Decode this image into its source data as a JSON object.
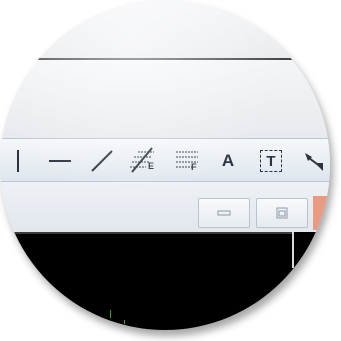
{
  "toolbar": {
    "tools": [
      {
        "name": "vertical-line-tool-icon",
        "label": ""
      },
      {
        "name": "horizontal-line-tool-icon",
        "label": ""
      },
      {
        "name": "diagonal-line-tool-icon",
        "label": ""
      },
      {
        "name": "fibonacci-extension-tool-icon",
        "label": "E"
      },
      {
        "name": "fibonacci-retracement-tool-icon",
        "label": "F"
      },
      {
        "name": "text-label-tool-icon",
        "label": "A"
      },
      {
        "name": "text-box-tool-icon",
        "label": "T"
      },
      {
        "name": "arrow-tool-icon",
        "label": ""
      }
    ]
  },
  "window_controls": {
    "minimize_icon": "minimize-icon",
    "restore_icon": "restore-icon"
  },
  "colors": {
    "toolbar_icon": "#2d3440",
    "canvas_background": "#000000",
    "close_button": "#e89a82",
    "chart_tick": "#2aa14b"
  }
}
